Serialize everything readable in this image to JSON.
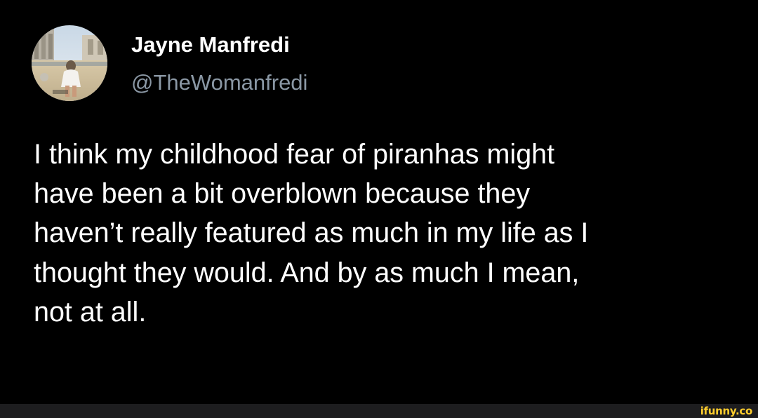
{
  "tweet": {
    "author": {
      "display_name": "Jayne Manfredi",
      "handle": "@TheWomanfredi",
      "avatar_icon": "profile-photo-avatar"
    },
    "text": "I think my childhood fear of piranhas might\nhave been a bit overblown because they\nhaven’t really featured as much in my life as I\nthought they would. And by as much I mean,\nnot at all."
  },
  "watermark": {
    "text": "ifunny.co",
    "color": "#fecd2d"
  },
  "colors": {
    "background": "#000000",
    "primary_text": "#ffffff",
    "secondary_text": "#8b98a5",
    "watermark_bar": "#1d1d1f"
  }
}
